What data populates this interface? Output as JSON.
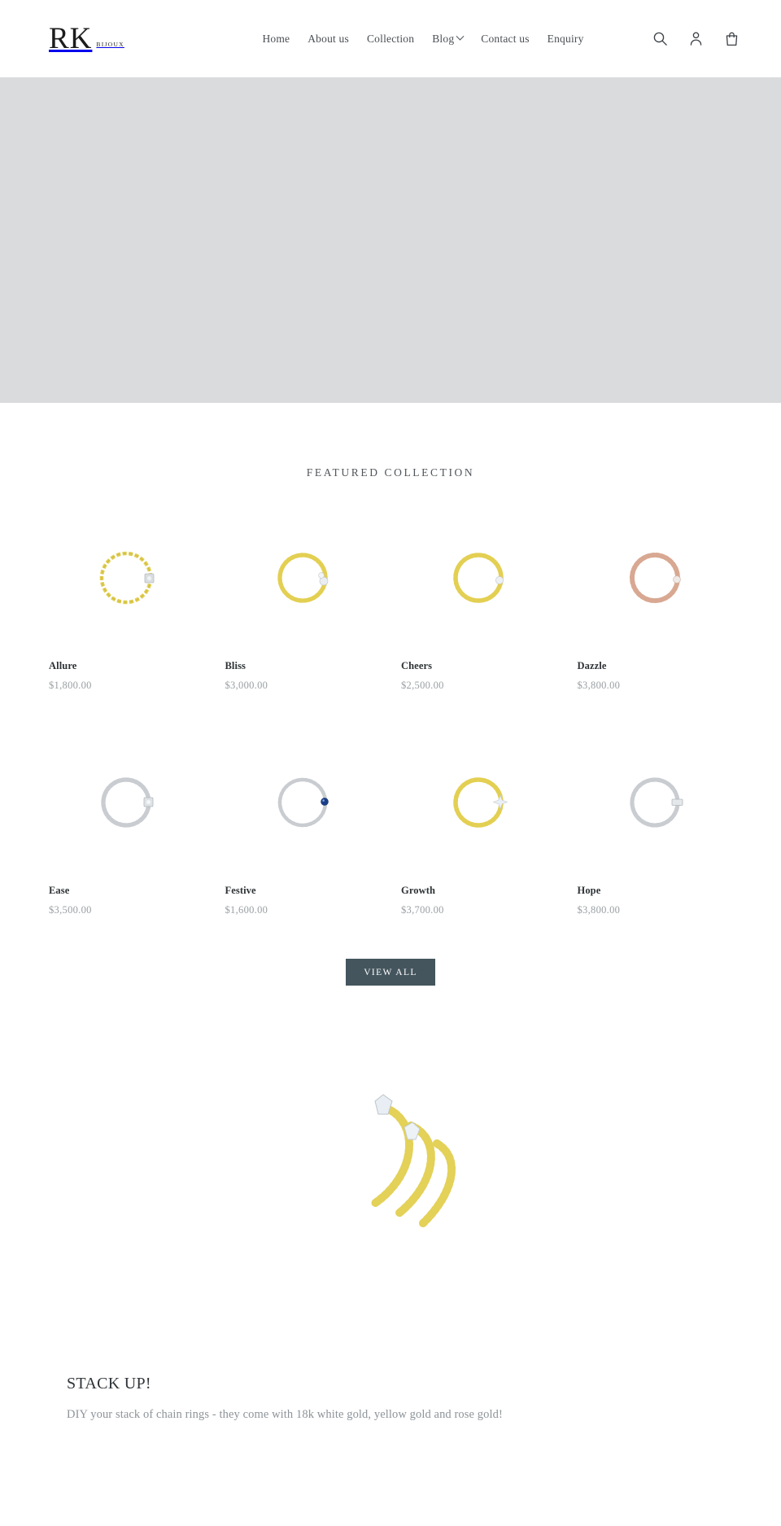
{
  "header": {
    "logo_main": "RK",
    "logo_sub": "BIJOUX",
    "nav": [
      {
        "label": "Home",
        "has_dropdown": false
      },
      {
        "label": "About us",
        "has_dropdown": false
      },
      {
        "label": "Collection",
        "has_dropdown": false
      },
      {
        "label": "Blog",
        "has_dropdown": true
      },
      {
        "label": "Contact us",
        "has_dropdown": false
      },
      {
        "label": "Enquiry",
        "has_dropdown": false
      }
    ],
    "icons": [
      "search-icon",
      "account-icon",
      "cart-icon"
    ]
  },
  "hero": {
    "background_color": "#dadbdd"
  },
  "featured": {
    "title": "FEATURED COLLECTION",
    "view_all_label": "VIEW ALL",
    "products": [
      {
        "name": "Allure",
        "price": "$1,800.00",
        "metal": "#e3cf52",
        "style": "chain",
        "accent": "square-gem"
      },
      {
        "name": "Bliss",
        "price": "$3,000.00",
        "metal": "#e3cf52",
        "style": "bead",
        "accent": "cluster-gem"
      },
      {
        "name": "Cheers",
        "price": "$2,500.00",
        "metal": "#e3cf52",
        "style": "bead",
        "accent": "round-gem"
      },
      {
        "name": "Dazzle",
        "price": "$3,800.00",
        "metal": "#d8a892",
        "style": "bead",
        "accent": "round-gem"
      },
      {
        "name": "Ease",
        "price": "$3,500.00",
        "metal": "#c9ccd0",
        "style": "bead",
        "accent": "square-gem"
      },
      {
        "name": "Festive",
        "price": "$1,600.00",
        "metal": "#c9ccd0",
        "style": "bead",
        "accent": "blue-gem"
      },
      {
        "name": "Growth",
        "price": "$3,700.00",
        "metal": "#e3cf52",
        "style": "bead",
        "accent": "star-gem"
      },
      {
        "name": "Hope",
        "price": "$3,800.00",
        "metal": "#c9ccd0",
        "style": "chain",
        "accent": "bar-gem"
      }
    ]
  },
  "stack": {
    "heading": "STACK UP!",
    "description": "DIY your stack of chain rings - they come with 18k white gold, yellow gold and rose gold!"
  },
  "colors": {
    "accent_button": "#44555d",
    "hero_grey": "#dadbdd",
    "text_primary": "#2e3336",
    "text_muted": "#9aa0a4",
    "gold": "#e3cf52",
    "rose_gold": "#d8a892",
    "white_gold": "#c9ccd0"
  }
}
